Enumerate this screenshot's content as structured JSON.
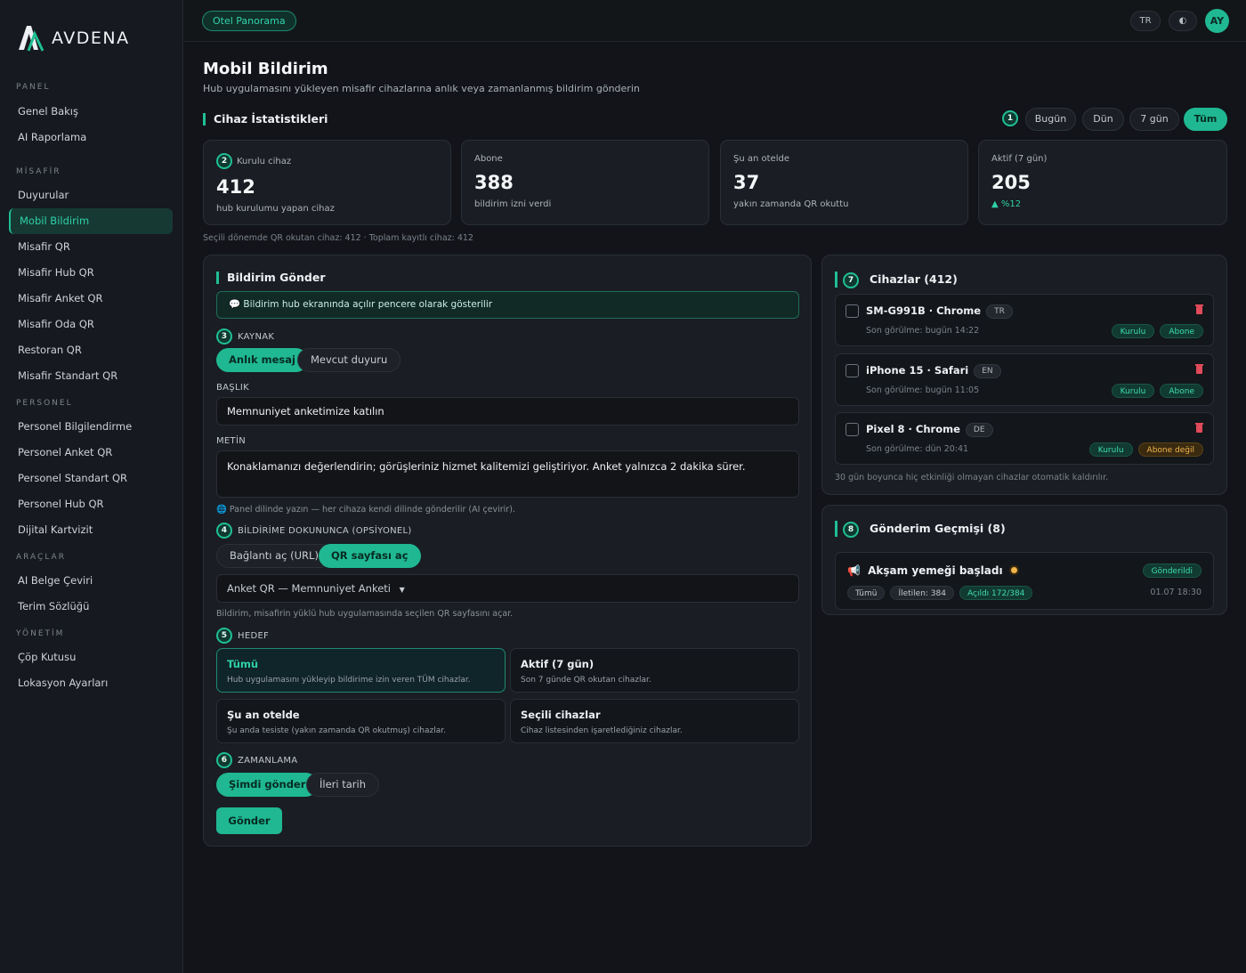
{
  "brand": {
    "name": "AVDENA"
  },
  "sidebar": {
    "sections": [
      {
        "title": "PANEL",
        "items": [
          "Genel Bakış",
          "AI Raporlama"
        ]
      },
      {
        "title": "MİSAFİR",
        "items": [
          "Duyurular",
          "Mobil Bildirim",
          "Misafir QR",
          "Misafir Hub QR",
          "Misafir Anket QR",
          "Misafir Oda QR",
          "Restoran QR",
          "Misafir Standart QR"
        ]
      },
      {
        "title": "PERSONEL",
        "items": [
          "Personel Bilgilendirme",
          "Personel Anket QR",
          "Personel Standart QR",
          "Personel Hub QR",
          "Dijital Kartvizit"
        ]
      },
      {
        "title": "ARAÇLAR",
        "items": [
          "AI Belge Çeviri",
          "Terim Sözlüğü"
        ]
      },
      {
        "title": "YÖNETİM",
        "items": [
          "Çöp Kutusu",
          "Lokasyon Ayarları"
        ]
      }
    ],
    "active": "Mobil Bildirim"
  },
  "topbar": {
    "hotel": "Otel Panorama",
    "lang": "TR",
    "theme_icon": "◐",
    "avatar": "AY"
  },
  "page": {
    "title": "Mobil Bildirim",
    "subtitle": "Hub uygulamasını yükleyen misafir cihazlarına anlık veya zamanlanmış bildirim gönderin"
  },
  "stats_section": {
    "title": "Cihaz İstatistikleri",
    "ranges": [
      "Bugün",
      "Dün",
      "7 gün",
      "Tüm"
    ],
    "active_range": "Tüm",
    "cards": [
      {
        "label": "Kurulu cihaz",
        "value": "412",
        "sub": "hub kurulumu yapan cihaz"
      },
      {
        "label": "Abone",
        "value": "388",
        "sub": "bildirim izni verdi"
      },
      {
        "label": "Şu an otelde",
        "value": "37",
        "sub": "yakın zamanda QR okuttu"
      },
      {
        "label": "Aktif (7 gün)",
        "value": "205",
        "sub": "▲ %12"
      }
    ],
    "note": "Seçili dönemde QR okutan cihaz: 412 · Toplam kayıtlı cihaz: 412"
  },
  "send": {
    "title": "Bildirim Gönder",
    "info": "💬 Bildirim hub ekranında açılır pencere olarak gösterilir",
    "source_label": "KAYNAK",
    "source_options": [
      "Anlık mesaj",
      "Mevcut duyuru"
    ],
    "title_label": "BAŞLIK",
    "title_value": "Memnuniyet anketimize katılın",
    "body_label": "METİN",
    "body_value": "Konaklamanızı değerlendirin; görüşleriniz hizmet kalitemizi geliştiriyor. Anket yalnızca 2 dakika sürer.",
    "lang_help": "🌐 Panel dilinde yazın — her cihaza kendi dilinde gönderilir (AI çevirir).",
    "tap_label": "BİLDİRİME DOKUNUNCA (OPSİYONEL)",
    "tap_options": [
      "Bağlantı aç (URL)",
      "QR sayfası aç"
    ],
    "qr_select": "Anket QR — Memnuniyet Anketi",
    "qr_help": "Bildirim, misafirin yüklü hub uygulamasında seçilen QR sayfasını açar.",
    "target_label": "HEDEF",
    "targets": [
      {
        "title": "Tümü",
        "desc": "Hub uygulamasını yükleyip bildirime izin veren TÜM cihazlar."
      },
      {
        "title": "Aktif (7 gün)",
        "desc": "Son 7 günde QR okutan cihazlar."
      },
      {
        "title": "Şu an otelde",
        "desc": "Şu anda tesiste (yakın zamanda QR okutmuş) cihazlar."
      },
      {
        "title": "Seçili cihazlar",
        "desc": "Cihaz listesinden işaretlediğiniz cihazlar."
      }
    ],
    "schedule_label": "ZAMANLAMA",
    "schedule_options": [
      "Şimdi gönder",
      "İleri tarih"
    ],
    "submit": "Gönder"
  },
  "devices": {
    "title": "Cihazlar (412)",
    "items": [
      {
        "name": "SM-G991B · Chrome",
        "lang": "TR",
        "seen": "Son görülme: bugün 14:22",
        "badges": [
          "Kurulu",
          "Abone"
        ]
      },
      {
        "name": "iPhone 15 · Safari",
        "lang": "EN",
        "seen": "Son görülme: bugün 11:05",
        "badges": [
          "Kurulu",
          "Abone"
        ]
      },
      {
        "name": "Pixel 8 · Chrome",
        "lang": "DE",
        "seen": "Son görülme: dün 20:41",
        "badges": [
          "Kurulu",
          "Abone değil"
        ]
      }
    ],
    "note": "30 gün boyunca hiç etkinliği olmayan cihazlar otomatik kaldırılır."
  },
  "history": {
    "title": "Gönderim Geçmişi (8)",
    "item": {
      "icon": "📢",
      "title": "Akşam yemeği başladı",
      "status": "Gönderildi",
      "chips": [
        "Tümü",
        "İletilen: 384",
        "Açıldı 172/384"
      ],
      "date": "01.07 18:30"
    }
  },
  "steps": [
    "1",
    "2",
    "3",
    "4",
    "5",
    "6",
    "7",
    "8"
  ],
  "colors": {
    "accent": "#1fb892",
    "background": "#121419",
    "warn": "#f1b54a",
    "danger": "#e04a5a"
  }
}
